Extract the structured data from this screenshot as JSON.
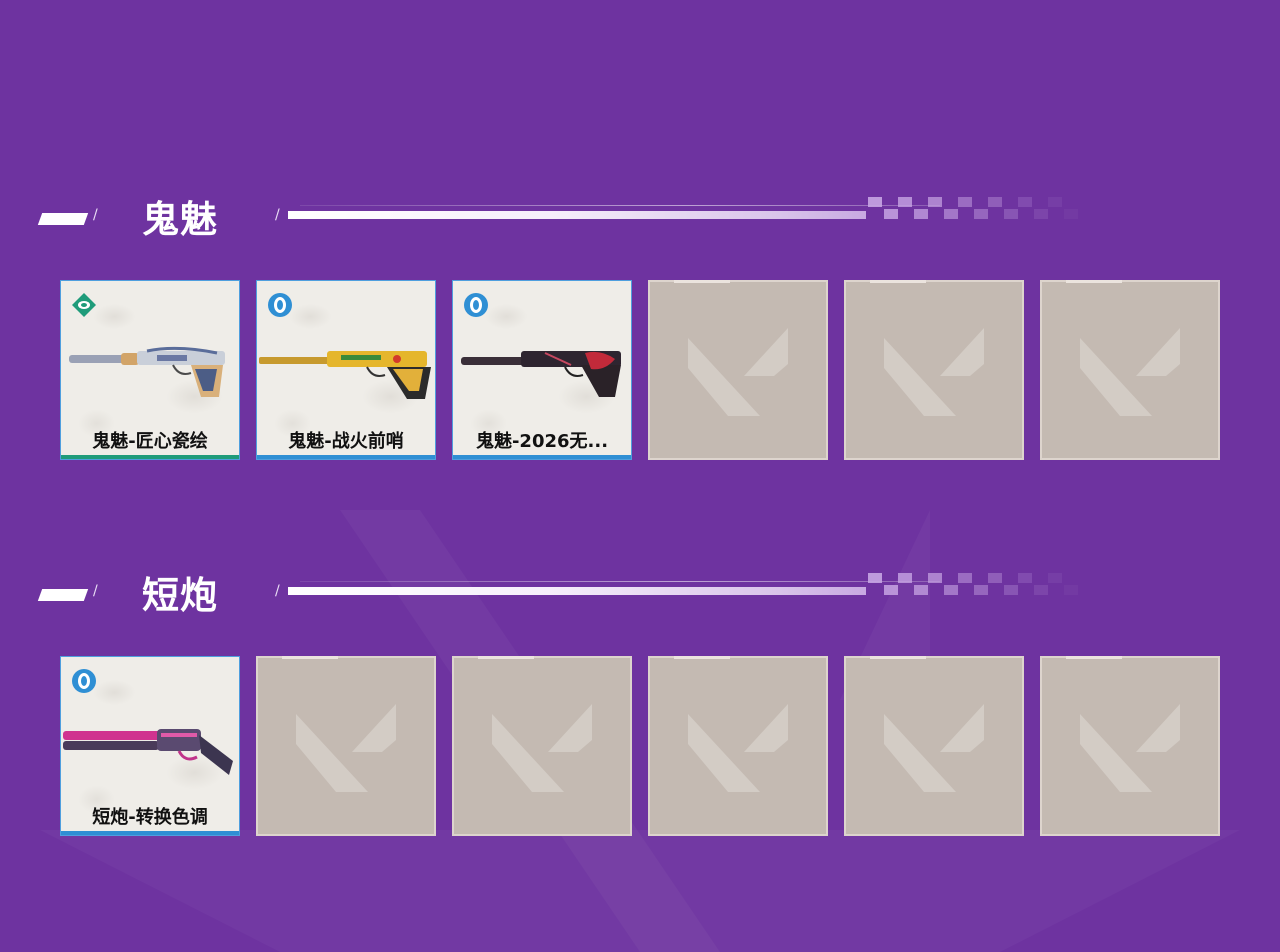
{
  "colors": {
    "background": "#6e33a0",
    "card_background": "#efede8",
    "empty_slot": "#c4bab2",
    "tier_green": "#1f9c7a",
    "tier_blue": "#2f8fd4"
  },
  "sections": [
    {
      "title": "鬼魅",
      "divider_slash": "/",
      "items": [
        {
          "name": "鬼魅-匠心瓷绘",
          "tier_icon": "tier-diamond-icon",
          "tier_color": "#1f9c7a",
          "weapon_icon": "ghost-pistol-porcelain-icon"
        },
        {
          "name": "鬼魅-战火前哨",
          "tier_icon": "tier-ring-icon",
          "tier_color": "#2f8fd4",
          "weapon_icon": "ghost-pistol-yellow-icon"
        },
        {
          "name": "鬼魅-2026无...",
          "tier_icon": "tier-ring-icon",
          "tier_color": "#2f8fd4",
          "weapon_icon": "ghost-pistol-dark-red-icon"
        }
      ],
      "empty_slots": 3
    },
    {
      "title": "短炮",
      "divider_slash": "/",
      "items": [
        {
          "name": "短炮-转换色调",
          "tier_icon": "tier-ring-icon",
          "tier_color": "#2f8fd4",
          "weapon_icon": "shorty-pink-icon"
        }
      ],
      "empty_slots": 5
    }
  ]
}
